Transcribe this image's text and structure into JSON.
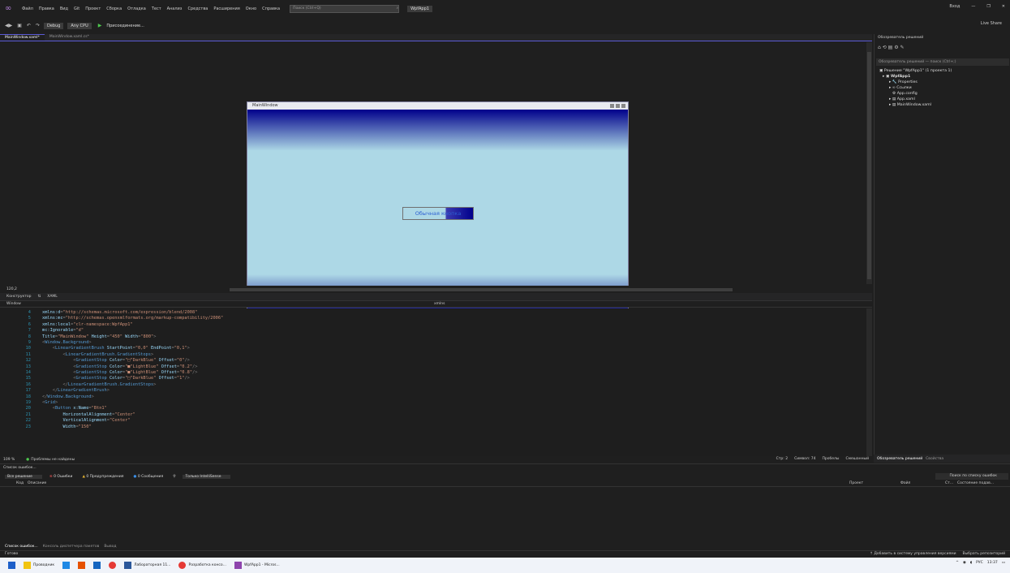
{
  "menu": {
    "items": [
      "Файл",
      "Правка",
      "Вид",
      "Git",
      "Проект",
      "Сборка",
      "Отладка",
      "Тест",
      "Анализ",
      "Средства",
      "Расширения",
      "Окно",
      "Справка"
    ],
    "search_placeholder": "Поиск (Ctrl+Q)",
    "project": "WpfApp1",
    "signin": "Вход"
  },
  "toolbar": {
    "config": "Debug",
    "platform": "Any CPU",
    "attach": "Присоединение...",
    "liveshare": "Live Share"
  },
  "tabs": {
    "active": "MainWindow.xaml*",
    "inactive": "MainWindow.xaml.cs*"
  },
  "designer": {
    "window_title": "MainWindow",
    "button_text": "Обычная кнопка",
    "zoom": "120,2"
  },
  "split": {
    "designer": "Конструктор",
    "xaml": "XAML"
  },
  "nav": {
    "left": "Window",
    "right": "xmlns"
  },
  "code": [
    {
      "n": "4",
      "t": [
        [
          "attr",
          "xmlns:d"
        ],
        [
          "pun",
          "="
        ],
        [
          "val",
          "\"http://schemas.microsoft.com/expression/blend/2008\""
        ]
      ]
    },
    {
      "n": "5",
      "t": [
        [
          "attr",
          "xmlns:mc"
        ],
        [
          "pun",
          "="
        ],
        [
          "val",
          "\"http://schemas.openxmlformats.org/markup-compatibility/2006\""
        ]
      ]
    },
    {
      "n": "6",
      "t": [
        [
          "attr",
          "xmlns:local"
        ],
        [
          "pun",
          "="
        ],
        [
          "val",
          "\"clr-namespace:WpfApp1\""
        ]
      ]
    },
    {
      "n": "7",
      "t": [
        [
          "attr",
          "mc:Ignorable"
        ],
        [
          "pun",
          "="
        ],
        [
          "val",
          "\"d\""
        ]
      ]
    },
    {
      "n": "8",
      "t": [
        [
          "attr",
          "Title"
        ],
        [
          "pun",
          "="
        ],
        [
          "val",
          "\"MainWindow\""
        ],
        [
          "attr",
          " Height"
        ],
        [
          "pun",
          "="
        ],
        [
          "val",
          "\"450\""
        ],
        [
          "attr",
          " Width"
        ],
        [
          "pun",
          "="
        ],
        [
          "val",
          "\"800\""
        ],
        [
          "pun",
          ">"
        ]
      ]
    },
    {
      "n": "9",
      "t": [
        [
          "pun",
          "<"
        ],
        [
          "tag",
          "Window.Background"
        ],
        [
          "pun",
          ">"
        ]
      ]
    },
    {
      "n": "10",
      "t": [
        [
          "pun",
          "    <"
        ],
        [
          "tag",
          "LinearGradientBrush"
        ],
        [
          "attr",
          " StartPoint"
        ],
        [
          "pun",
          "="
        ],
        [
          "val",
          "\"0,0\""
        ],
        [
          "attr",
          " EndPoint"
        ],
        [
          "pun",
          "="
        ],
        [
          "val",
          "\"0,1\""
        ],
        [
          "pun",
          ">"
        ]
      ]
    },
    {
      "n": "11",
      "t": [
        [
          "pun",
          "        <"
        ],
        [
          "tag",
          "LinearGradientBrush.GradientStops"
        ],
        [
          "pun",
          ">"
        ]
      ]
    },
    {
      "n": "12",
      "t": [
        [
          "pun",
          "            <"
        ],
        [
          "tag",
          "GradientStop"
        ],
        [
          "attr",
          " Color"
        ],
        [
          "pun",
          "="
        ],
        [
          "val",
          "\"□\"DarkBlue\""
        ],
        [
          "attr",
          " Offset"
        ],
        [
          "pun",
          "="
        ],
        [
          "val",
          "\"0\""
        ],
        [
          "pun",
          "/>"
        ]
      ]
    },
    {
      "n": "13",
      "t": [
        [
          "pun",
          "            <"
        ],
        [
          "tag",
          "GradientStop"
        ],
        [
          "attr",
          " Color"
        ],
        [
          "pun",
          "="
        ],
        [
          "val",
          "\"■\"LightBlue\""
        ],
        [
          "attr",
          " Offset"
        ],
        [
          "pun",
          "="
        ],
        [
          "val",
          "\"0.2\""
        ],
        [
          "pun",
          "/>"
        ]
      ]
    },
    {
      "n": "14",
      "t": [
        [
          "pun",
          "            <"
        ],
        [
          "tag",
          "GradientStop"
        ],
        [
          "attr",
          " Color"
        ],
        [
          "pun",
          "="
        ],
        [
          "val",
          "\"■\"LightBlue\""
        ],
        [
          "attr",
          " Offset"
        ],
        [
          "pun",
          "="
        ],
        [
          "val",
          "\"0.8\""
        ],
        [
          "pun",
          "/>"
        ]
      ]
    },
    {
      "n": "15",
      "t": [
        [
          "pun",
          "            <"
        ],
        [
          "tag",
          "GradientStop"
        ],
        [
          "attr",
          " Color"
        ],
        [
          "pun",
          "="
        ],
        [
          "val",
          "\"□\"DarkBlue\""
        ],
        [
          "attr",
          " Offset"
        ],
        [
          "pun",
          "="
        ],
        [
          "val",
          "\"1\""
        ],
        [
          "pun",
          "/>"
        ]
      ]
    },
    {
      "n": "16",
      "t": [
        [
          "pun",
          "        </"
        ],
        [
          "tag",
          "LinearGradientBrush.GradientStops"
        ],
        [
          "pun",
          ">"
        ]
      ]
    },
    {
      "n": "17",
      "t": [
        [
          "pun",
          "    </"
        ],
        [
          "tag",
          "LinearGradientBrush"
        ],
        [
          "pun",
          ">"
        ]
      ]
    },
    {
      "n": "18",
      "t": [
        [
          "pun",
          "</"
        ],
        [
          "tag",
          "Window.Background"
        ],
        [
          "pun",
          ">"
        ]
      ]
    },
    {
      "n": "19",
      "t": [
        [
          "pun",
          "<"
        ],
        [
          "tag",
          "Grid"
        ],
        [
          "pun",
          ">"
        ]
      ]
    },
    {
      "n": "20",
      "t": [
        [
          "pun",
          "    <"
        ],
        [
          "tag",
          "Button"
        ],
        [
          "attr",
          " x:Name"
        ],
        [
          "pun",
          "="
        ],
        [
          "val",
          "\"Btn1\""
        ]
      ]
    },
    {
      "n": "21",
      "t": [
        [
          "attr",
          "        HorizontalAlignment"
        ],
        [
          "pun",
          "="
        ],
        [
          "val",
          "\"Center\""
        ]
      ]
    },
    {
      "n": "22",
      "t": [
        [
          "attr",
          "        VerticalAlignment"
        ],
        [
          "pun",
          "="
        ],
        [
          "val",
          "\"Center\""
        ]
      ]
    },
    {
      "n": "23",
      "t": [
        [
          "attr",
          "        Width"
        ],
        [
          "pun",
          "="
        ],
        [
          "val",
          "\"150\""
        ]
      ]
    }
  ],
  "codestatus": {
    "zoom": "109 %",
    "problems": "Проблемы не найдены",
    "line": "Стр: 2",
    "char": "Символ: 74",
    "spaces": "Пробелы",
    "crlf": "Смешанный"
  },
  "solution": {
    "header": "Обозреватель решений",
    "search": "Обозреватель решений — поиск (Ctrl+;)",
    "solution_node": "Решение \"WpfApp1\" (1 проекта 1)",
    "project": "WpfApp1",
    "items": [
      "Properties",
      "Ссылки",
      "App.config",
      "App.xaml",
      "MainWindow.xaml"
    ],
    "tab1": "Обозреватель решений",
    "tab2": "Свойства"
  },
  "errors": {
    "title": "Список ошибок...",
    "scope": "Все решение",
    "errors": "0 Ошибки",
    "warnings": "0 Предупреждения",
    "messages": "0 Сообщения",
    "intellisense": "Только IntelliSense",
    "search": "Поиск по списку ошибок",
    "col_code": "Код",
    "col_desc": "Описание",
    "col_project": "Проект",
    "col_file": "Файл",
    "col_line": "Ст...",
    "col_state": "Состояние подав..."
  },
  "bottomtabs": [
    "Список ошибок...",
    "Консоль диспетчера пакетов",
    "Вывод"
  ],
  "status": {
    "ready": "Готово",
    "vcs": "↑ Добавить в систему управления версиями",
    "repo": "Выбрать репозиторий"
  },
  "taskbar": {
    "explorer": "Проводник",
    "lab": "Лабораторная 11...",
    "dev": "Разработка консо...",
    "vs": "WpfApp1 - Micros...",
    "lang": "РУС",
    "time": "13:37"
  }
}
